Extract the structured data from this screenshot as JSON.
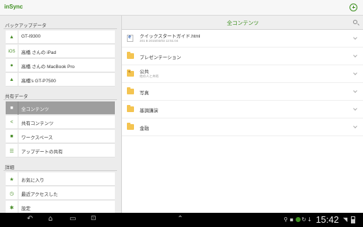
{
  "app": {
    "title": "inSync"
  },
  "backup": {
    "heading": "バックアップデータ",
    "devices": [
      {
        "label": "GT-I9300",
        "icon": "android-icon",
        "glyph": "▲"
      },
      {
        "label": "高橋 さんの iPad",
        "icon": "ios-icon",
        "glyph": "iOS"
      },
      {
        "label": "高橋 さんの MacBook Pro",
        "icon": "apple-icon",
        "glyph": "●"
      },
      {
        "label": "高橋's GT-P7500",
        "icon": "android-check-icon",
        "glyph": "▲"
      }
    ]
  },
  "shared": {
    "heading": "共有データ",
    "items": [
      {
        "label": "全コンテンツ",
        "icon": "folder-icon",
        "glyph": "■",
        "active": true
      },
      {
        "label": "共有コンテンツ",
        "icon": "share-icon",
        "glyph": "<"
      },
      {
        "label": "ワークスペース",
        "icon": "folder-icon",
        "glyph": "■"
      },
      {
        "label": "アップデートの共有",
        "icon": "list-icon",
        "glyph": "☰"
      }
    ]
  },
  "details": {
    "heading": "詳細",
    "items": [
      {
        "label": "お気に入り",
        "icon": "star-icon",
        "glyph": "★"
      },
      {
        "label": "最近アクセスした",
        "icon": "clock-icon",
        "glyph": "◷"
      },
      {
        "label": "設定",
        "icon": "gear-icon",
        "glyph": "✱"
      }
    ]
  },
  "content": {
    "title": "全コンテンツ",
    "files": [
      {
        "name": "クイックスタートガイド.html",
        "sub": "201 B   2015/03/03 12:51:04",
        "type": "html"
      },
      {
        "name": "プレゼンテーション",
        "sub": "",
        "type": "folder"
      },
      {
        "name": "公共",
        "sub": "他の人と共有",
        "type": "shared-folder"
      },
      {
        "name": "写真",
        "sub": "",
        "type": "folder"
      },
      {
        "name": "基調講演",
        "sub": "",
        "type": "folder"
      },
      {
        "name": "金融",
        "sub": "",
        "type": "folder"
      }
    ]
  },
  "system_bar": {
    "time": "15:42",
    "back": "↶",
    "home": "⌂",
    "recent": "▭",
    "screenshot": "⊡",
    "up": "⌃"
  },
  "colors": {
    "accent": "#3d8f1f",
    "active_item": "#9e9e9e",
    "folder": "#f4c451"
  }
}
